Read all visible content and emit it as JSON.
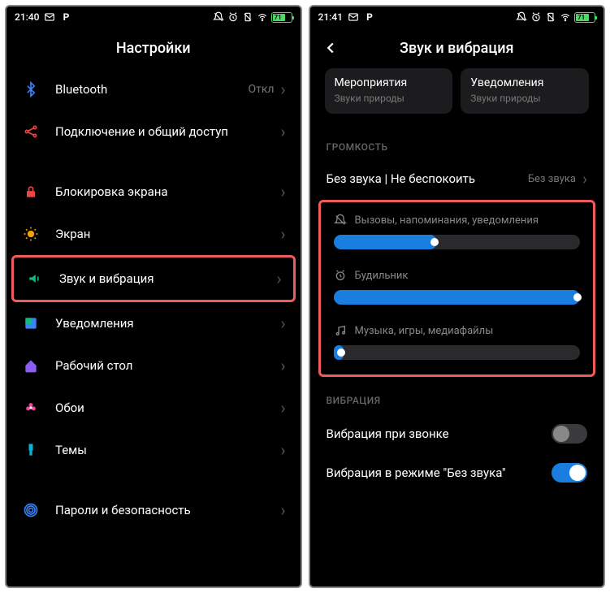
{
  "left": {
    "status": {
      "time": "21:40",
      "battery_pct": 71
    },
    "title": "Настройки",
    "rows": [
      {
        "icon": "bluetooth",
        "label": "Bluetooth",
        "value": "Откл"
      },
      {
        "icon": "share",
        "label": "Подключение и общий доступ",
        "value": ""
      },
      {
        "gap": true
      },
      {
        "icon": "lock",
        "label": "Блокировка экрана",
        "value": ""
      },
      {
        "icon": "sun",
        "label": "Экран",
        "value": ""
      },
      {
        "icon": "sound",
        "label": "Звук и вибрация",
        "value": "",
        "highlight": true
      },
      {
        "icon": "notif",
        "label": "Уведомления",
        "value": ""
      },
      {
        "icon": "home",
        "label": "Рабочий стол",
        "value": ""
      },
      {
        "icon": "flower",
        "label": "Обои",
        "value": ""
      },
      {
        "icon": "brush",
        "label": "Темы",
        "value": ""
      },
      {
        "gap": true
      },
      {
        "icon": "finger",
        "label": "Пароли и безопасность",
        "value": ""
      }
    ]
  },
  "right": {
    "status": {
      "time": "21:41",
      "battery_pct": 71
    },
    "title": "Звук и вибрация",
    "chips": [
      {
        "title": "Мероприятия",
        "sub": "Звуки природы"
      },
      {
        "title": "Уведомления",
        "sub": "Звуки природы"
      }
    ],
    "volume": {
      "section": "ГРОМКОСТЬ",
      "silent_row": {
        "label": "Без звука | Не беспокоить",
        "value": "Без звука"
      },
      "sliders": [
        {
          "icon": "bell",
          "label": "Вызовы, напоминания, уведомления",
          "pct": 42
        },
        {
          "icon": "alarm",
          "label": "Будильник",
          "pct": 100
        },
        {
          "icon": "music",
          "label": "Музыка, игры, медиафайлы",
          "pct": 4
        }
      ]
    },
    "vibration": {
      "section": "ВИБРАЦИЯ",
      "toggles": [
        {
          "label": "Вибрация при звонке",
          "on": false
        },
        {
          "label": "Вибрация в режиме \"Без звука\"",
          "on": true
        }
      ]
    }
  }
}
